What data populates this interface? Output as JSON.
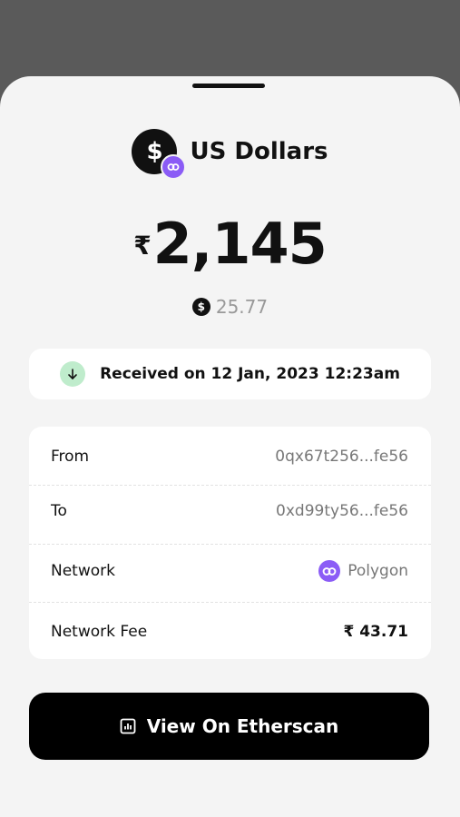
{
  "currency": {
    "symbol": "$",
    "name": "US Dollars",
    "network_icon": "polygon-icon"
  },
  "amount": {
    "symbol": "₹",
    "value": "2,145"
  },
  "sub_amount": {
    "symbol": "$",
    "value": "25.77"
  },
  "status": {
    "icon": "arrow-down-icon",
    "text": "Received on 12 Jan, 2023  12:23am",
    "icon_bg": "#bfeccc"
  },
  "details": {
    "from": {
      "label": "From",
      "value": "0qx67t256...fe56"
    },
    "to": {
      "label": "To",
      "value": "0xd99ty56...fe56"
    },
    "network": {
      "label": "Network",
      "value": "Polygon"
    },
    "fee": {
      "label": "Network Fee",
      "value": "₹ 43.71"
    }
  },
  "button": {
    "icon": "chart-icon",
    "label": "View On Etherscan"
  },
  "colors": {
    "polygon": "#8b5cf6",
    "primary": "#000000",
    "background": "#f4f4f4"
  }
}
